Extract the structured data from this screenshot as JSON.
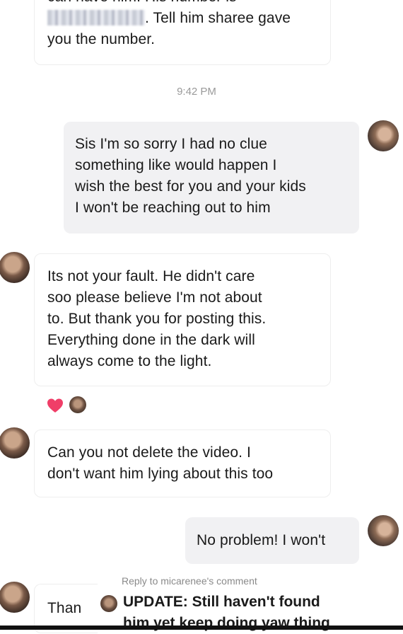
{
  "messages": [
    {
      "id": "top",
      "lines": [
        "can have him. His number is",
        ". Tell him sharee gave",
        "you the number."
      ]
    },
    {
      "id": "sorry",
      "lines": [
        "Sis I'm so sorry I had no clue",
        "something like would happen I",
        "wish the best for you and your kids",
        "I won't be reaching out to him"
      ]
    },
    {
      "id": "fault",
      "lines": [
        "Its not your fault. He didn't care",
        "soo please believe I'm not about",
        "to. But thank you for posting this.",
        "Everything done in the dark will",
        "always come to the light."
      ]
    },
    {
      "id": "delete",
      "lines": [
        "Can you not delete the video. I",
        "don't want him lying about this too"
      ]
    },
    {
      "id": "noproblem",
      "lines": [
        "No problem! I won't"
      ]
    },
    {
      "id": "thanks",
      "lines": [
        "Than"
      ]
    }
  ],
  "timestamp": "9:42 PM",
  "reply_banner": "Reply to micarenee's comment",
  "update": {
    "line1": "UPDATE: Still haven't found",
    "line2": "him yet keep doing yaw thing"
  },
  "icons": {
    "heart": "heart-icon",
    "heart_color": "#f03e68"
  }
}
